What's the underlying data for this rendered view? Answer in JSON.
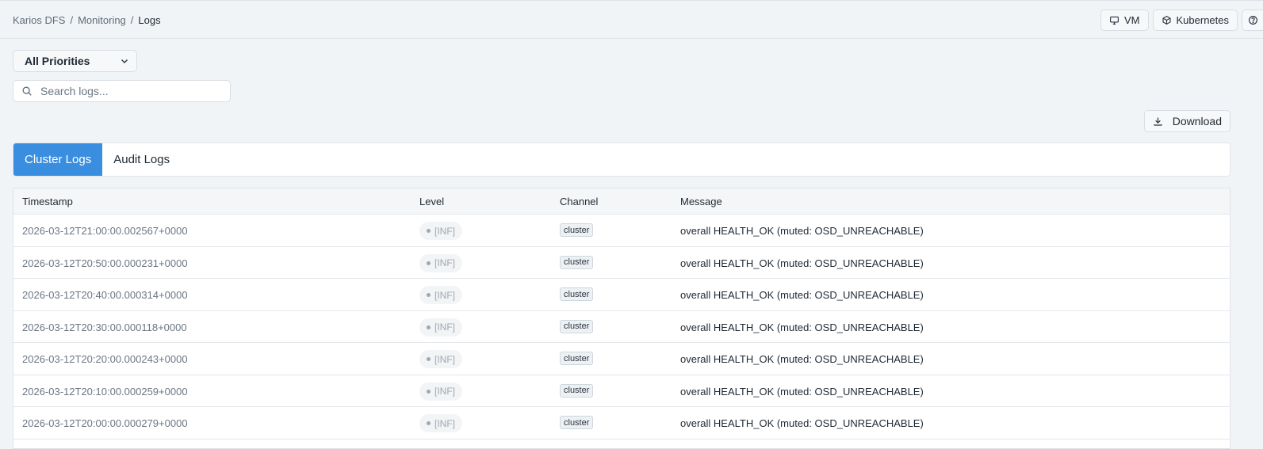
{
  "breadcrumb": {
    "root": "Karios DFS",
    "sep1": "/",
    "section": "Monitoring",
    "sep2": "/",
    "current": "Logs"
  },
  "top_actions": {
    "vm_label": "VM",
    "vm_icon": "monitor-icon",
    "kubernetes_label": "Kubernetes",
    "kubernetes_icon": "cube-icon",
    "help_icon": "help-circle-icon"
  },
  "filters": {
    "priority_selected": "All Priorities",
    "search_placeholder": "Search logs...",
    "search_value": ""
  },
  "download_label": "Download",
  "tabs": [
    {
      "label": "Cluster Logs",
      "active": true
    },
    {
      "label": "Audit Logs",
      "active": false
    }
  ],
  "table": {
    "headers": {
      "timestamp": "Timestamp",
      "level": "Level",
      "channel": "Channel",
      "message": "Message"
    },
    "rows": [
      {
        "timestamp": "2026-03-12T21:00:00.002567+0000",
        "level": "[INF]",
        "channel": "cluster",
        "message": "overall HEALTH_OK (muted: OSD_UNREACHABLE)"
      },
      {
        "timestamp": "2026-03-12T20:50:00.000231+0000",
        "level": "[INF]",
        "channel": "cluster",
        "message": "overall HEALTH_OK (muted: OSD_UNREACHABLE)"
      },
      {
        "timestamp": "2026-03-12T20:40:00.000314+0000",
        "level": "[INF]",
        "channel": "cluster",
        "message": "overall HEALTH_OK (muted: OSD_UNREACHABLE)"
      },
      {
        "timestamp": "2026-03-12T20:30:00.000118+0000",
        "level": "[INF]",
        "channel": "cluster",
        "message": "overall HEALTH_OK (muted: OSD_UNREACHABLE)"
      },
      {
        "timestamp": "2026-03-12T20:20:00.000243+0000",
        "level": "[INF]",
        "channel": "cluster",
        "message": "overall HEALTH_OK (muted: OSD_UNREACHABLE)"
      },
      {
        "timestamp": "2026-03-12T20:10:00.000259+0000",
        "level": "[INF]",
        "channel": "cluster",
        "message": "overall HEALTH_OK (muted: OSD_UNREACHABLE)"
      },
      {
        "timestamp": "2026-03-12T20:00:00.000279+0000",
        "level": "[INF]",
        "channel": "cluster",
        "message": "overall HEALTH_OK (muted: OSD_UNREACHABLE)"
      }
    ]
  },
  "colors": {
    "accent": "#3a8ee0",
    "background": "#f1f4f7"
  }
}
